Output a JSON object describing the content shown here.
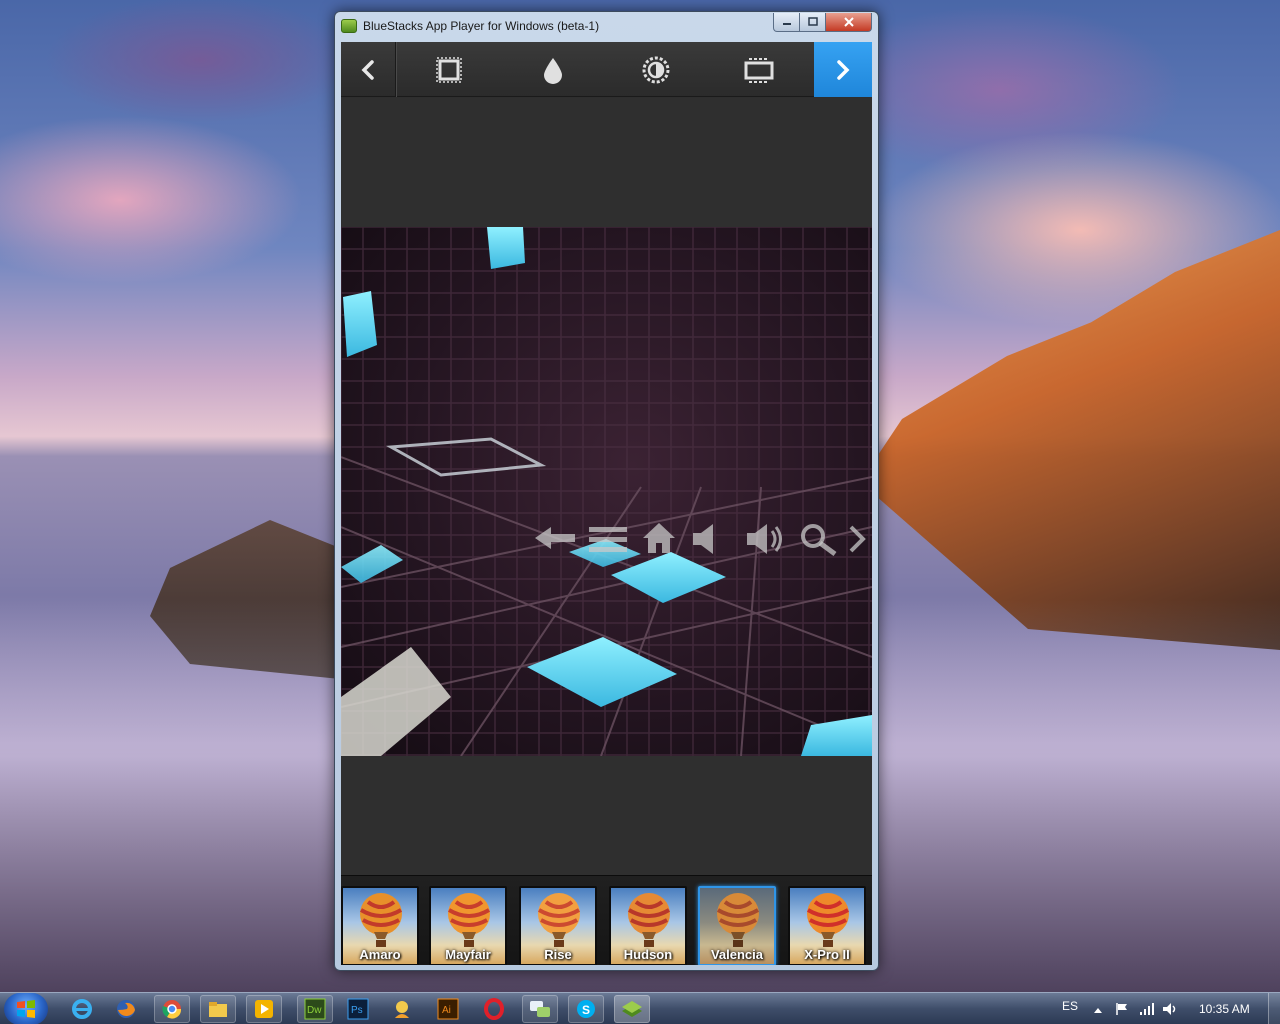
{
  "window": {
    "title": "BlueStacks App Player for Windows (beta-1)",
    "controls": {
      "minimize_icon": "minimize-icon",
      "maximize_icon": "maximize-icon",
      "close_icon": "close-icon"
    }
  },
  "toolbar": {
    "items": [
      {
        "id": "back",
        "icon": "chevron-left-icon"
      },
      {
        "id": "frame",
        "icon": "frame-icon"
      },
      {
        "id": "drop",
        "icon": "drop-icon"
      },
      {
        "id": "brightness",
        "icon": "brightness-icon"
      },
      {
        "id": "crop",
        "icon": "crop-icon"
      },
      {
        "id": "next",
        "icon": "chevron-right-icon"
      }
    ],
    "accent": "#2f95e8"
  },
  "overlay_nav": {
    "icons": [
      "back-arrow-icon",
      "menu-icon",
      "home-icon",
      "volume-down-icon",
      "volume-up-icon",
      "search-icon",
      "chevron-right-icon"
    ]
  },
  "filters": {
    "items": [
      {
        "label": "Amaro",
        "selected": false
      },
      {
        "label": "Mayfair",
        "selected": false
      },
      {
        "label": "Rise",
        "selected": false
      },
      {
        "label": "Hudson",
        "selected": false
      },
      {
        "label": "Valencia",
        "selected": true
      },
      {
        "label": "X-Pro II",
        "selected": false
      }
    ]
  },
  "taskbar": {
    "apps": [
      "start-orb-icon",
      "internet-explorer-icon",
      "firefox-icon",
      "chrome-icon",
      "explorer-icon",
      "media-player-icon",
      "dreamweaver-icon",
      "photoshop-icon",
      "messenger-icon",
      "illustrator-icon",
      "opera-icon",
      "chat-icon",
      "skype-icon",
      "bluestacks-icon"
    ],
    "dw_label": "Dw",
    "ps_label": "Ps",
    "ai_label": "Ai",
    "language": "ES",
    "clock": "10:35 AM"
  }
}
